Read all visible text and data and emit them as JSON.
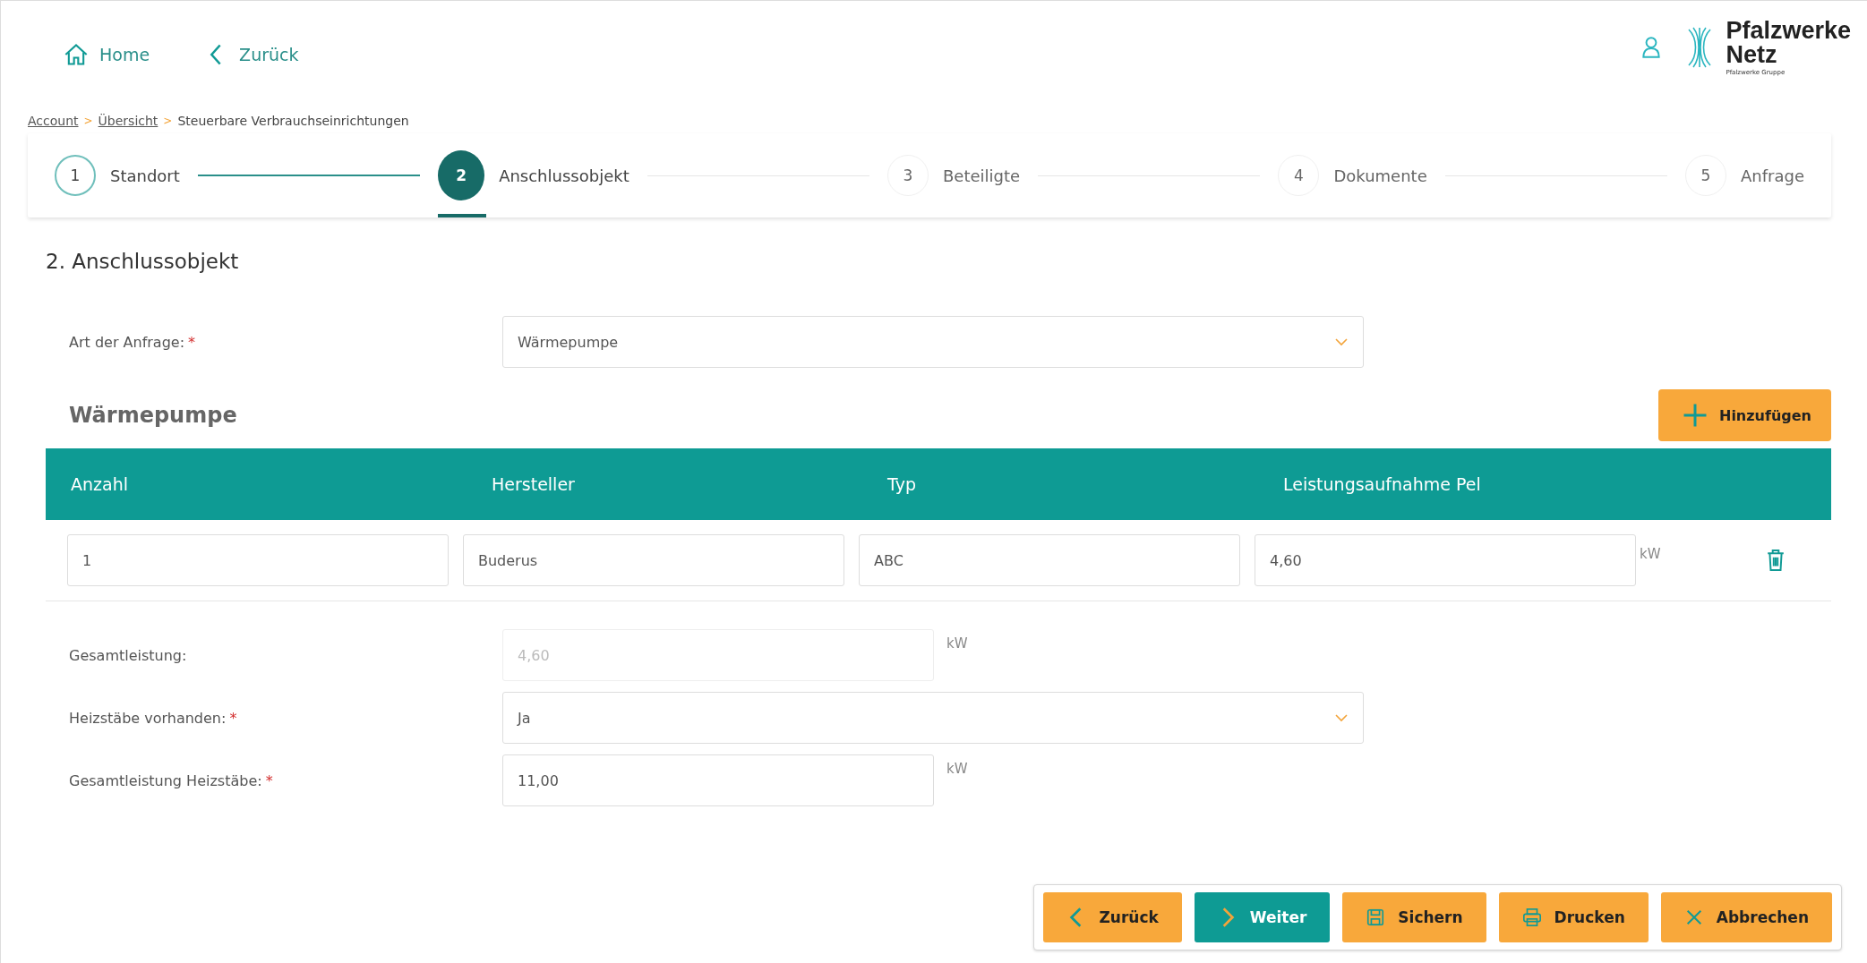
{
  "nav": {
    "home": "Home",
    "back": "Zurück"
  },
  "logo": {
    "name_line1": "Pfalzwerke",
    "name_line2": "Netz",
    "tagline": "Pfalzwerke Gruppe"
  },
  "breadcrumb": [
    {
      "label": "Account",
      "link": true
    },
    {
      "label": "Übersicht",
      "link": true
    },
    {
      "label": "Steuerbare Verbrauchseinrichtungen",
      "link": false
    }
  ],
  "breadcrumb_separator": ">",
  "steps": [
    {
      "number": "1",
      "label": "Standort",
      "completed": true,
      "selected": false
    },
    {
      "number": "2",
      "label": "Anschlussobjekt",
      "completed": false,
      "selected": true
    },
    {
      "number": "3",
      "label": "Beteiligte",
      "completed": false,
      "selected": false
    },
    {
      "number": "4",
      "label": "Dokumente",
      "completed": false,
      "selected": false
    },
    {
      "number": "5",
      "label": "Anfrage",
      "completed": false,
      "selected": false
    }
  ],
  "section_title": "2. Anschlussobjekt",
  "request_type": {
    "label": "Art der Anfrage:",
    "required": true,
    "kind": "select",
    "value": "Wärmepumpe"
  },
  "table": {
    "title": "Wärmepumpe",
    "add_button": "Hinzufügen",
    "columns": [
      "Anzahl",
      "Hersteller",
      "Typ",
      "Leistungsaufnahme Pel"
    ],
    "rows": [
      {
        "cells": [
          "1",
          "Buderus",
          "ABC",
          "4,60"
        ],
        "unit": "kW"
      }
    ]
  },
  "fields": [
    {
      "label": "Gesamtleistung:",
      "required": false,
      "kind": "input",
      "value": "4,60",
      "unit": "kW",
      "disabled": true
    },
    {
      "label": "Heizstäbe vorhanden:",
      "required": true,
      "kind": "select",
      "value": "Ja",
      "disabled": false
    },
    {
      "label": "Gesamtleistung Heizstäbe:",
      "required": true,
      "kind": "input",
      "value": "11,00",
      "unit": "kW",
      "disabled": false
    }
  ],
  "required_mark": "*",
  "actions": [
    {
      "label": "Zurück",
      "kind": "back",
      "primary": false
    },
    {
      "label": "Weiter",
      "kind": "next",
      "primary": true
    },
    {
      "label": "Sichern",
      "kind": "save",
      "primary": false
    },
    {
      "label": "Drucken",
      "kind": "print",
      "primary": false
    },
    {
      "label": "Abbrechen",
      "kind": "cancel",
      "primary": false
    }
  ]
}
